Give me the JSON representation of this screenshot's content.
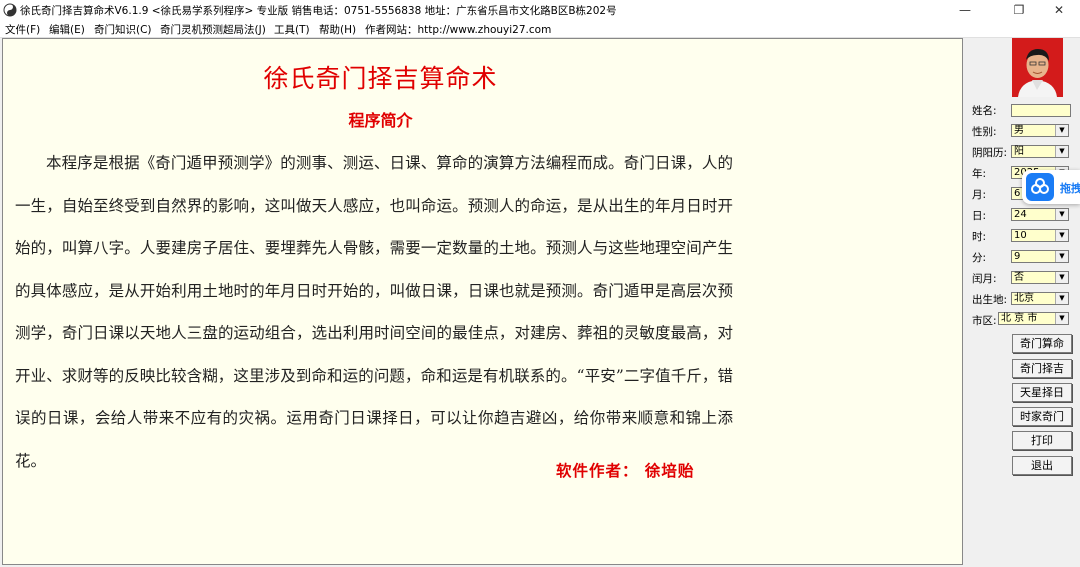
{
  "window": {
    "title": "徐氏奇门择吉算命术V6.1.9 <徐氏易学系列程序> 专业版   销售电话：0751-5556838   地址：广东省乐昌市文化路B区B栋202号",
    "minimize": "—",
    "maximize": "❐",
    "close": "✕"
  },
  "menu": [
    "文件(F)",
    "编辑(E)",
    "奇门知识(C)",
    "奇门灵机预测超局法(J)",
    "工具(T)",
    "帮助(H)",
    "作者网站：http://www.zhouyi27.com"
  ],
  "main": {
    "title": "徐氏奇门择吉算命术",
    "subtitle": "程序简介",
    "body": "本程序是根据《奇门遁甲预测学》的测事、测运、日课、算命的演算方法编程而成。奇门日课，人的一生，自始至终受到自然界的影响，这叫做天人感应，也叫命运。预测人的命运，是从出生的年月日时开始的，叫算八字。人要建房子居住、要埋葬先人骨骸，需要一定数量的土地。预测人与这些地理空间产生的具体感应，是从开始利用土地时的年月日时开始的，叫做日课，日课也就是预测。奇门遁甲是高层次预测学，奇门日课以天地人三盘的运动组合，选出利用时间空间的最佳点，对建房、葬祖的灵敏度最高，对开业、求财等的反映比较含糊，这里涉及到命和运的问题，命和运是有机联系的。“平安”二字值千斤，错误的日课，会给人带来不应有的灾祸。运用奇门日课择日，可以让你趋吉避凶，给你带来顺意和锦上添花。",
    "author": "软件作者：  徐培贻"
  },
  "form": {
    "name_label": "姓名:",
    "name_value": "",
    "gender_label": "性别:",
    "gender_value": "男",
    "calendar_label": "阴阳历:",
    "calendar_value": "阳",
    "year_label": "年:",
    "year_value": "2025",
    "month_label": "月:",
    "month_value": "6",
    "day_label": "日:",
    "day_value": "24",
    "hour_label": "时:",
    "hour_value": "10",
    "minute_label": "分:",
    "minute_value": "9",
    "leap_label": "闰月:",
    "leap_value": "否",
    "birthplace_label": "出生地:",
    "birthplace_value": "北京",
    "city_label": "市区:",
    "city_value": "北 京 市"
  },
  "buttons": {
    "qimen_suanming": "奇门算命",
    "qimen_zeji": "奇门择吉",
    "tianxing_zeri": "天星择日",
    "shijia_qimen": "时家奇门",
    "print": "打印",
    "exit": "退出"
  },
  "floating_widget": {
    "label": "拖拽",
    "icon": "cloud-icon"
  },
  "colors": {
    "accent_red": "#e00000",
    "paper": "#ffffee",
    "field": "#ffffcc"
  }
}
